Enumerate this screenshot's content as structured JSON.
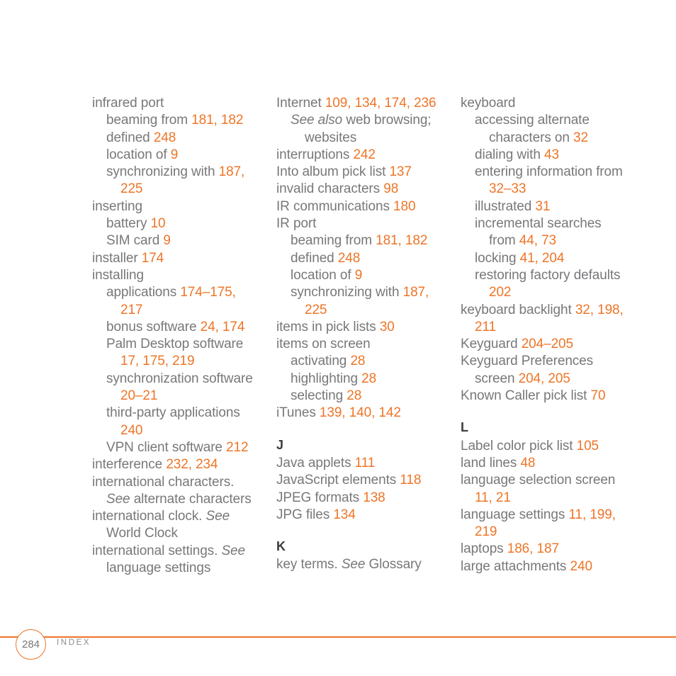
{
  "page": {
    "number": "284",
    "footer_label": "INDEX",
    "accent_color": "#ee7527",
    "text_color": "#78787b",
    "heading_color": "#3c3c3e",
    "background_color": "#ffffff"
  },
  "columns": [
    {
      "entries": [
        {
          "level": 0,
          "parts": [
            {
              "t": "infrared port",
              "s": "text"
            }
          ]
        },
        {
          "level": 1,
          "parts": [
            {
              "t": "beaming from ",
              "s": "text"
            },
            {
              "t": "181, 182",
              "s": "page"
            }
          ]
        },
        {
          "level": 1,
          "parts": [
            {
              "t": "defined ",
              "s": "text"
            },
            {
              "t": "248",
              "s": "page"
            }
          ]
        },
        {
          "level": 1,
          "parts": [
            {
              "t": "location of ",
              "s": "text"
            },
            {
              "t": "9",
              "s": "page"
            }
          ]
        },
        {
          "level": 1,
          "parts": [
            {
              "t": "synchronizing with ",
              "s": "text"
            },
            {
              "t": "187, 225",
              "s": "page"
            }
          ]
        },
        {
          "level": 0,
          "parts": [
            {
              "t": "inserting",
              "s": "text"
            }
          ]
        },
        {
          "level": 1,
          "parts": [
            {
              "t": "battery ",
              "s": "text"
            },
            {
              "t": "10",
              "s": "page"
            }
          ]
        },
        {
          "level": 1,
          "parts": [
            {
              "t": "SIM card ",
              "s": "text"
            },
            {
              "t": "9",
              "s": "page"
            }
          ]
        },
        {
          "level": 0,
          "parts": [
            {
              "t": "installer ",
              "s": "text"
            },
            {
              "t": "174",
              "s": "page"
            }
          ]
        },
        {
          "level": 0,
          "parts": [
            {
              "t": "installing",
              "s": "text"
            }
          ]
        },
        {
          "level": 1,
          "parts": [
            {
              "t": "applications ",
              "s": "text"
            },
            {
              "t": "174–175, 217",
              "s": "page"
            }
          ]
        },
        {
          "level": 1,
          "parts": [
            {
              "t": "bonus software ",
              "s": "text"
            },
            {
              "t": "24, 174",
              "s": "page"
            }
          ]
        },
        {
          "level": 1,
          "parts": [
            {
              "t": "Palm Desktop software ",
              "s": "text"
            },
            {
              "t": "17, 175, 219",
              "s": "page"
            }
          ]
        },
        {
          "level": 1,
          "parts": [
            {
              "t": "synchronization software ",
              "s": "text"
            },
            {
              "t": "20–21",
              "s": "page"
            }
          ]
        },
        {
          "level": 1,
          "parts": [
            {
              "t": "third-party applications ",
              "s": "text"
            },
            {
              "t": "240",
              "s": "page"
            }
          ]
        },
        {
          "level": 1,
          "parts": [
            {
              "t": "VPN client software ",
              "s": "text"
            },
            {
              "t": "212",
              "s": "page"
            }
          ]
        },
        {
          "level": 0,
          "parts": [
            {
              "t": "interference ",
              "s": "text"
            },
            {
              "t": "232, 234",
              "s": "page"
            }
          ]
        },
        {
          "level": 0,
          "parts": [
            {
              "t": "international characters. ",
              "s": "text"
            },
            {
              "t": "See",
              "s": "see"
            },
            {
              "t": " alternate characters",
              "s": "text"
            }
          ]
        },
        {
          "level": 0,
          "parts": [
            {
              "t": "international clock. ",
              "s": "text"
            },
            {
              "t": "See",
              "s": "see"
            },
            {
              "t": " World Clock",
              "s": "text"
            }
          ]
        },
        {
          "level": 0,
          "parts": [
            {
              "t": "international settings. ",
              "s": "text"
            },
            {
              "t": "See",
              "s": "see"
            },
            {
              "t": " language settings",
              "s": "text"
            }
          ]
        }
      ]
    },
    {
      "entries": [
        {
          "level": 0,
          "parts": [
            {
              "t": "Internet ",
              "s": "text"
            },
            {
              "t": "109, 134, 174, 236",
              "s": "page"
            }
          ]
        },
        {
          "level": 1,
          "parts": [
            {
              "t": "See also",
              "s": "see"
            },
            {
              "t": " web browsing; websites",
              "s": "text"
            }
          ]
        },
        {
          "level": 0,
          "parts": [
            {
              "t": "interruptions ",
              "s": "text"
            },
            {
              "t": "242",
              "s": "page"
            }
          ]
        },
        {
          "level": 0,
          "parts": [
            {
              "t": "Into album pick list ",
              "s": "text"
            },
            {
              "t": "137",
              "s": "page"
            }
          ]
        },
        {
          "level": 0,
          "parts": [
            {
              "t": "invalid characters ",
              "s": "text"
            },
            {
              "t": "98",
              "s": "page"
            }
          ]
        },
        {
          "level": 0,
          "parts": [
            {
              "t": "IR communications ",
              "s": "text"
            },
            {
              "t": "180",
              "s": "page"
            }
          ]
        },
        {
          "level": 0,
          "parts": [
            {
              "t": "IR port",
              "s": "text"
            }
          ]
        },
        {
          "level": 1,
          "parts": [
            {
              "t": "beaming from ",
              "s": "text"
            },
            {
              "t": "181, 182",
              "s": "page"
            }
          ]
        },
        {
          "level": 1,
          "parts": [
            {
              "t": "defined ",
              "s": "text"
            },
            {
              "t": "248",
              "s": "page"
            }
          ]
        },
        {
          "level": 1,
          "parts": [
            {
              "t": "location of ",
              "s": "text"
            },
            {
              "t": "9",
              "s": "page"
            }
          ]
        },
        {
          "level": 1,
          "parts": [
            {
              "t": "synchronizing with ",
              "s": "text"
            },
            {
              "t": "187, 225",
              "s": "page"
            }
          ]
        },
        {
          "level": 0,
          "parts": [
            {
              "t": "items in pick lists ",
              "s": "text"
            },
            {
              "t": "30",
              "s": "page"
            }
          ]
        },
        {
          "level": 0,
          "parts": [
            {
              "t": "items on screen",
              "s": "text"
            }
          ]
        },
        {
          "level": 1,
          "parts": [
            {
              "t": "activating ",
              "s": "text"
            },
            {
              "t": "28",
              "s": "page"
            }
          ]
        },
        {
          "level": 1,
          "parts": [
            {
              "t": "highlighting ",
              "s": "text"
            },
            {
              "t": "28",
              "s": "page"
            }
          ]
        },
        {
          "level": 1,
          "parts": [
            {
              "t": "selecting ",
              "s": "text"
            },
            {
              "t": "28",
              "s": "page"
            }
          ]
        },
        {
          "level": 0,
          "parts": [
            {
              "t": "iTunes ",
              "s": "text"
            },
            {
              "t": "139, 140, 142",
              "s": "page"
            }
          ]
        },
        {
          "heading": "J"
        },
        {
          "level": 0,
          "parts": [
            {
              "t": "Java applets ",
              "s": "text"
            },
            {
              "t": "111",
              "s": "page"
            }
          ]
        },
        {
          "level": 0,
          "parts": [
            {
              "t": "JavaScript elements ",
              "s": "text"
            },
            {
              "t": "118",
              "s": "page"
            }
          ]
        },
        {
          "level": 0,
          "parts": [
            {
              "t": "JPEG formats ",
              "s": "text"
            },
            {
              "t": "138",
              "s": "page"
            }
          ]
        },
        {
          "level": 0,
          "parts": [
            {
              "t": "JPG files ",
              "s": "text"
            },
            {
              "t": "134",
              "s": "page"
            }
          ]
        },
        {
          "heading": "K"
        },
        {
          "level": 0,
          "parts": [
            {
              "t": "key terms. ",
              "s": "text"
            },
            {
              "t": "See",
              "s": "see"
            },
            {
              "t": " Glossary",
              "s": "text"
            }
          ]
        }
      ]
    },
    {
      "entries": [
        {
          "level": 0,
          "parts": [
            {
              "t": "keyboard",
              "s": "text"
            }
          ]
        },
        {
          "level": 1,
          "parts": [
            {
              "t": "accessing alternate characters on ",
              "s": "text"
            },
            {
              "t": "32",
              "s": "page"
            }
          ]
        },
        {
          "level": 1,
          "parts": [
            {
              "t": "dialing with ",
              "s": "text"
            },
            {
              "t": "43",
              "s": "page"
            }
          ]
        },
        {
          "level": 1,
          "parts": [
            {
              "t": "entering information from ",
              "s": "text"
            },
            {
              "t": "32–33",
              "s": "page"
            }
          ]
        },
        {
          "level": 1,
          "parts": [
            {
              "t": "illustrated ",
              "s": "text"
            },
            {
              "t": "31",
              "s": "page"
            }
          ]
        },
        {
          "level": 1,
          "parts": [
            {
              "t": "incremental searches from ",
              "s": "text"
            },
            {
              "t": "44, 73",
              "s": "page"
            }
          ]
        },
        {
          "level": 1,
          "parts": [
            {
              "t": "locking ",
              "s": "text"
            },
            {
              "t": "41, 204",
              "s": "page"
            }
          ]
        },
        {
          "level": 1,
          "parts": [
            {
              "t": "restoring factory defaults ",
              "s": "text"
            },
            {
              "t": "202",
              "s": "page"
            }
          ]
        },
        {
          "level": 0,
          "parts": [
            {
              "t": "keyboard backlight ",
              "s": "text"
            },
            {
              "t": "32, 198, 211",
              "s": "page"
            }
          ]
        },
        {
          "level": 0,
          "parts": [
            {
              "t": "Keyguard ",
              "s": "text"
            },
            {
              "t": "204–205",
              "s": "page"
            }
          ]
        },
        {
          "level": 0,
          "parts": [
            {
              "t": "Keyguard Preferences screen ",
              "s": "text"
            },
            {
              "t": "204, 205",
              "s": "page"
            }
          ]
        },
        {
          "level": 0,
          "parts": [
            {
              "t": "Known Caller pick list ",
              "s": "text"
            },
            {
              "t": "70",
              "s": "page"
            }
          ]
        },
        {
          "heading": "L"
        },
        {
          "level": 0,
          "parts": [
            {
              "t": "Label color pick list ",
              "s": "text"
            },
            {
              "t": "105",
              "s": "page"
            }
          ]
        },
        {
          "level": 0,
          "parts": [
            {
              "t": "land lines ",
              "s": "text"
            },
            {
              "t": "48",
              "s": "page"
            }
          ]
        },
        {
          "level": 0,
          "parts": [
            {
              "t": "language selection screen ",
              "s": "text"
            },
            {
              "t": "11, 21",
              "s": "page"
            }
          ]
        },
        {
          "level": 0,
          "parts": [
            {
              "t": "language settings ",
              "s": "text"
            },
            {
              "t": "11, 199, 219",
              "s": "page"
            }
          ]
        },
        {
          "level": 0,
          "parts": [
            {
              "t": "laptops ",
              "s": "text"
            },
            {
              "t": "186, 187",
              "s": "page"
            }
          ]
        },
        {
          "level": 0,
          "parts": [
            {
              "t": "large attachments ",
              "s": "text"
            },
            {
              "t": "240",
              "s": "page"
            }
          ]
        }
      ]
    }
  ]
}
